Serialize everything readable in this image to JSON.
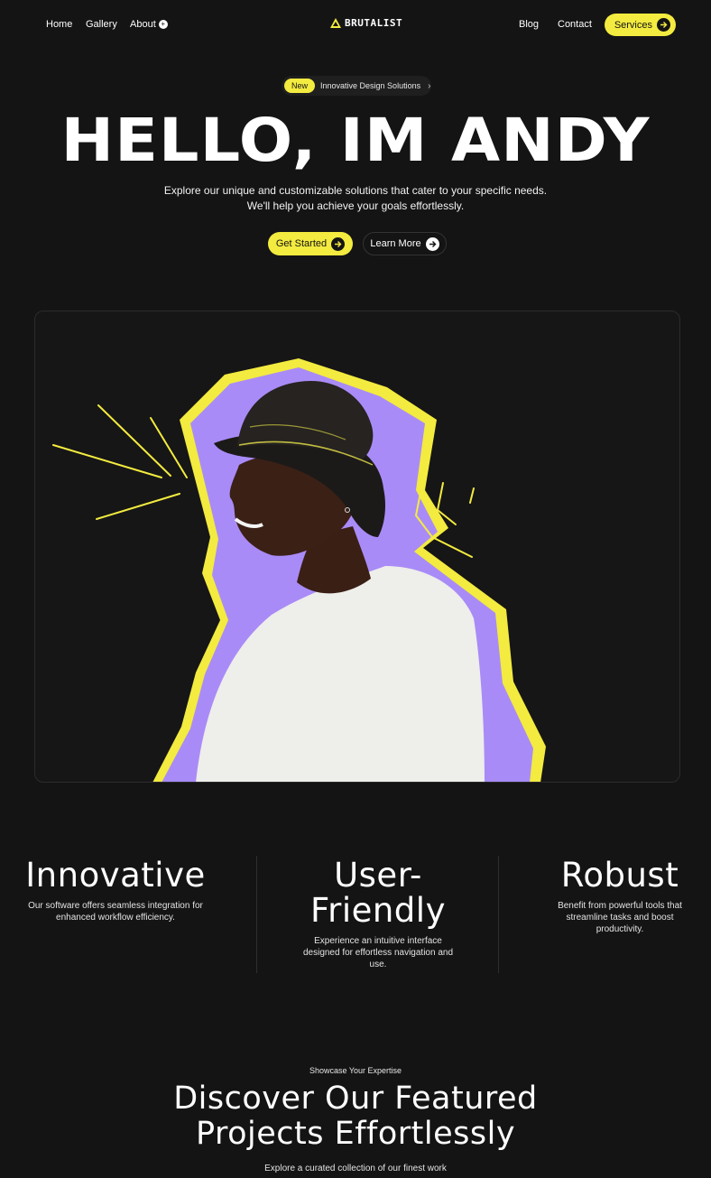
{
  "nav": {
    "home": "Home",
    "gallery": "Gallery",
    "about": "About",
    "about_badge": "+",
    "logo": "BRUTALIST",
    "blog": "Blog",
    "contact": "Contact",
    "services": "Services"
  },
  "badge": {
    "new": "New",
    "text": "Innovative Design Solutions"
  },
  "hero": {
    "title": "HELLO, IM ANDY",
    "subtitle_line1": "Explore our unique and customizable solutions that cater to your specific needs.",
    "subtitle_line2": "We'll help you achieve your goals effortlessly.",
    "get_started": "Get Started",
    "learn_more": "Learn More"
  },
  "features": [
    {
      "title": "Innovative",
      "text": "Our software offers seamless integration for enhanced workflow efficiency."
    },
    {
      "title_line1": "User-",
      "title_line2": "Friendly",
      "text": "Experience an intuitive interface designed for effortless navigation and use."
    },
    {
      "title": "Robust",
      "text": "Benefit from powerful tools that streamline tasks and boost productivity."
    }
  ],
  "projects": {
    "eyebrow": "Showcase Your Expertise",
    "title_line1": "Discover Our Featured",
    "title_line2": "Projects Effortlessly",
    "subtitle": "Explore a curated collection of our finest work"
  },
  "colors": {
    "accent": "#f3eb3f",
    "purple": "#a98bf7",
    "background": "#141414"
  }
}
